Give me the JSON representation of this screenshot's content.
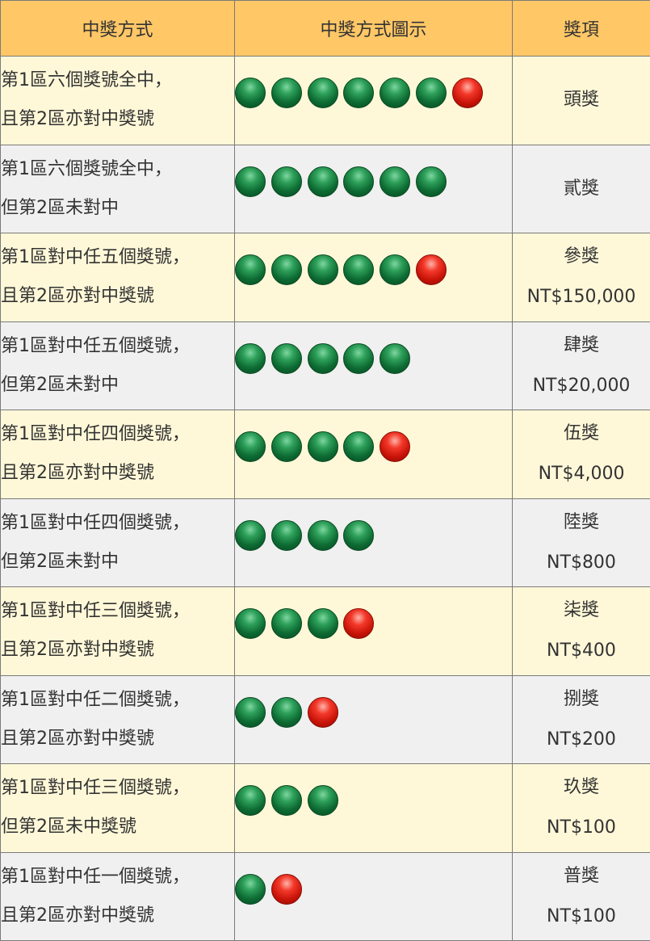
{
  "header": {
    "method": "中獎方式",
    "diagram": "中獎方式圖示",
    "prize": "獎項"
  },
  "ball_colors": {
    "green": "#0d6b33",
    "red": "#c81308",
    "header_bg": "#ffc766",
    "row_odd_bg": "#fff8d8",
    "row_even_bg": "#f0f0f0"
  },
  "rows": [
    {
      "line1": "第1區六個獎號全中，",
      "line2": "且第2區亦對中獎號",
      "green": 6,
      "red": 1,
      "prize": "頭獎",
      "amount": ""
    },
    {
      "line1": "第1區六個獎號全中，",
      "line2": "但第2區未對中",
      "green": 6,
      "red": 0,
      "prize": "貳獎",
      "amount": ""
    },
    {
      "line1": "第1區對中任五個獎號，",
      "line2": "且第2區亦對中獎號",
      "green": 5,
      "red": 1,
      "prize": "參獎",
      "amount": "NT$150,000"
    },
    {
      "line1": "第1區對中任五個獎號，",
      "line2": "但第2區未對中",
      "green": 5,
      "red": 0,
      "prize": "肆獎",
      "amount": "NT$20,000"
    },
    {
      "line1": "第1區對中任四個獎號，",
      "line2": "且第2區亦對中獎號",
      "green": 4,
      "red": 1,
      "prize": "伍獎",
      "amount": "NT$4,000"
    },
    {
      "line1": "第1區對中任四個獎號，",
      "line2": "但第2區未對中",
      "green": 4,
      "red": 0,
      "prize": "陸獎",
      "amount": "NT$800"
    },
    {
      "line1": "第1區對中任三個獎號，",
      "line2": "且第2區亦對中獎號",
      "green": 3,
      "red": 1,
      "prize": "柒獎",
      "amount": "NT$400"
    },
    {
      "line1": "第1區對中任二個獎號，",
      "line2": "且第2區亦對中獎號",
      "green": 2,
      "red": 1,
      "prize": "捌獎",
      "amount": "NT$200"
    },
    {
      "line1": "第1區對中任三個獎號，",
      "line2": "但第2區未中獎號",
      "green": 3,
      "red": 0,
      "prize": "玖獎",
      "amount": "NT$100"
    },
    {
      "line1": "第1區對中任一個獎號，",
      "line2": "且第2區亦對中獎號",
      "green": 1,
      "red": 1,
      "prize": "普獎",
      "amount": "NT$100"
    }
  ]
}
